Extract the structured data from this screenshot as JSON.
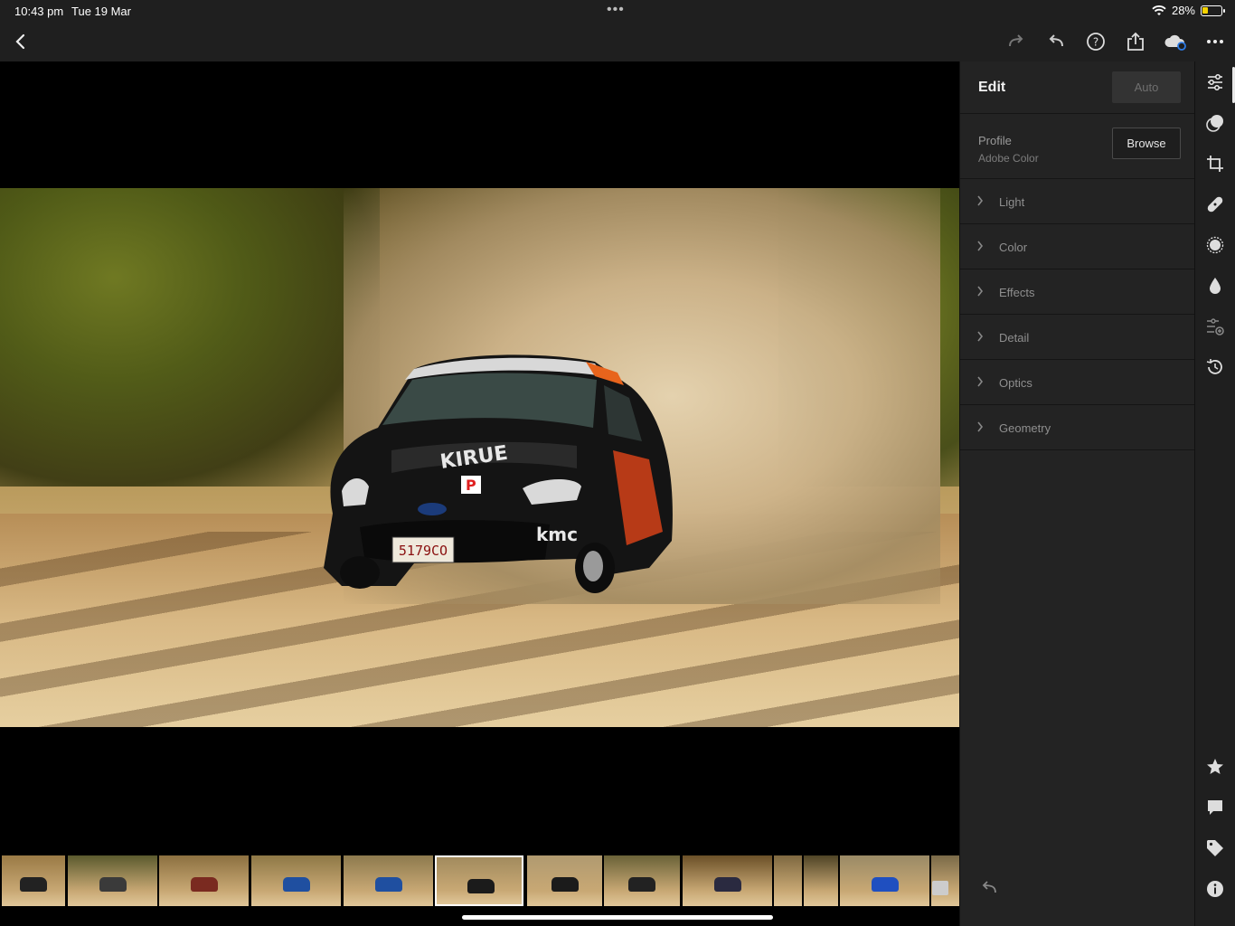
{
  "status": {
    "time": "10:43 pm",
    "date": "Tue 19 Mar",
    "battery": "28%",
    "battery_level": 0.28
  },
  "toolbar": {
    "back_icon": "chevron-left-icon",
    "redo_icon": "redo-icon",
    "undo_icon": "undo-icon",
    "help_icon": "help-icon",
    "share_icon": "share-icon",
    "cloud_icon": "cloud-sync-icon",
    "more_icon": "more-icon"
  },
  "panel": {
    "title": "Edit",
    "auto_label": "Auto",
    "profile_label": "Profile",
    "profile_value": "Adobe Color",
    "browse_label": "Browse",
    "sections": [
      "Light",
      "Color",
      "Effects",
      "Detail",
      "Optics",
      "Geometry"
    ]
  },
  "photo": {
    "plate": "5179CO",
    "brand": "kmc"
  },
  "strip": {
    "icons": [
      "edit-sliders-icon",
      "presets-icon",
      "crop-icon",
      "healing-icon",
      "masking-icon",
      "blur-icon",
      "versions-icon",
      "history-icon"
    ],
    "bottom_icons": [
      "star-icon",
      "comment-icon",
      "tag-icon",
      "info-icon"
    ]
  },
  "colors": {
    "bg": "#1f1f1f",
    "panel": "#232323",
    "accent": "#2d7be5"
  }
}
